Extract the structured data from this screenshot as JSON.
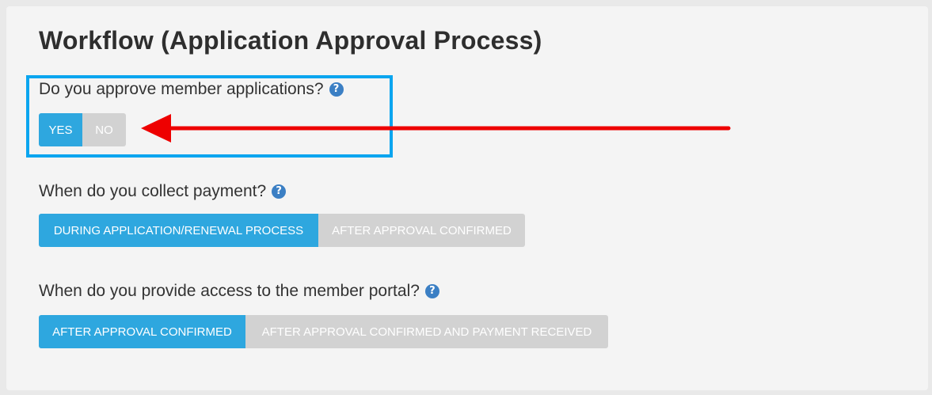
{
  "panel": {
    "title": "Workflow (Application Approval Process)"
  },
  "questions": [
    {
      "label": "Do you approve member applications?",
      "options": [
        "YES",
        "NO"
      ],
      "selected": "YES"
    },
    {
      "label": "When do you collect payment?",
      "options": [
        "DURING APPLICATION/RENEWAL PROCESS",
        "AFTER APPROVAL CONFIRMED"
      ],
      "selected": "DURING APPLICATION/RENEWAL PROCESS"
    },
    {
      "label": "When do you provide access to the member portal?",
      "options": [
        "AFTER APPROVAL CONFIRMED",
        "AFTER APPROVAL CONFIRMED AND PAYMENT RECEIVED"
      ],
      "selected": "AFTER APPROVAL CONFIRMED"
    }
  ],
  "help_icon": {
    "glyph": "?",
    "icon": "question-circle-icon",
    "color": "#3b7fc4"
  },
  "colors": {
    "active_toggle": "#2ea7df",
    "inactive_toggle": "#d2d2d2",
    "annotation_box": "#0aa5ef",
    "annotation_arrow": "#ee0000"
  }
}
